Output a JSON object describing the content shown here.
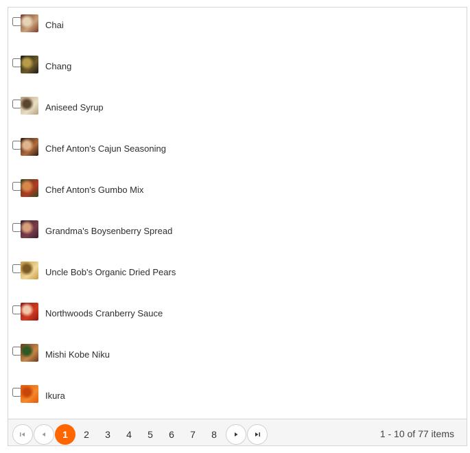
{
  "products": [
    {
      "name": "Chai",
      "colors": [
        "#7a3b2a",
        "#c9a27a",
        "#e6d3b5"
      ]
    },
    {
      "name": "Chang",
      "colors": [
        "#1b1a12",
        "#6e5b2a",
        "#b89b48"
      ]
    },
    {
      "name": "Aniseed Syrup",
      "colors": [
        "#b8a07c",
        "#e8dfc4",
        "#5b4430"
      ]
    },
    {
      "name": "Chef Anton's Cajun Seasoning",
      "colors": [
        "#2a1a12",
        "#b06b3c",
        "#e0b48a"
      ]
    },
    {
      "name": "Chef Anton's Gumbo Mix",
      "colors": [
        "#2f4a22",
        "#b43a22",
        "#d9864a"
      ]
    },
    {
      "name": "Grandma's Boysenberry Spread",
      "colors": [
        "#3a1f2a",
        "#7c3c4a",
        "#d7a07a"
      ]
    },
    {
      "name": "Uncle Bob's Organic Dried Pears",
      "colors": [
        "#c79a3e",
        "#f0d79a",
        "#7a5a22"
      ]
    },
    {
      "name": "Northwoods Cranberry Sauce",
      "colors": [
        "#8c1a12",
        "#d23a22",
        "#f1c6a9"
      ]
    },
    {
      "name": "Mishi Kobe Niku",
      "colors": [
        "#6a3a1c",
        "#c7874a",
        "#2e5a22"
      ]
    },
    {
      "name": "Ikura",
      "colors": [
        "#e35a0e",
        "#f38a2a",
        "#c9460a"
      ]
    }
  ],
  "pager": {
    "pages": [
      "1",
      "2",
      "3",
      "4",
      "5",
      "6",
      "7",
      "8"
    ],
    "current_page": "1",
    "info": "1 - 10 of 77 items",
    "accent": "#ff6600"
  }
}
